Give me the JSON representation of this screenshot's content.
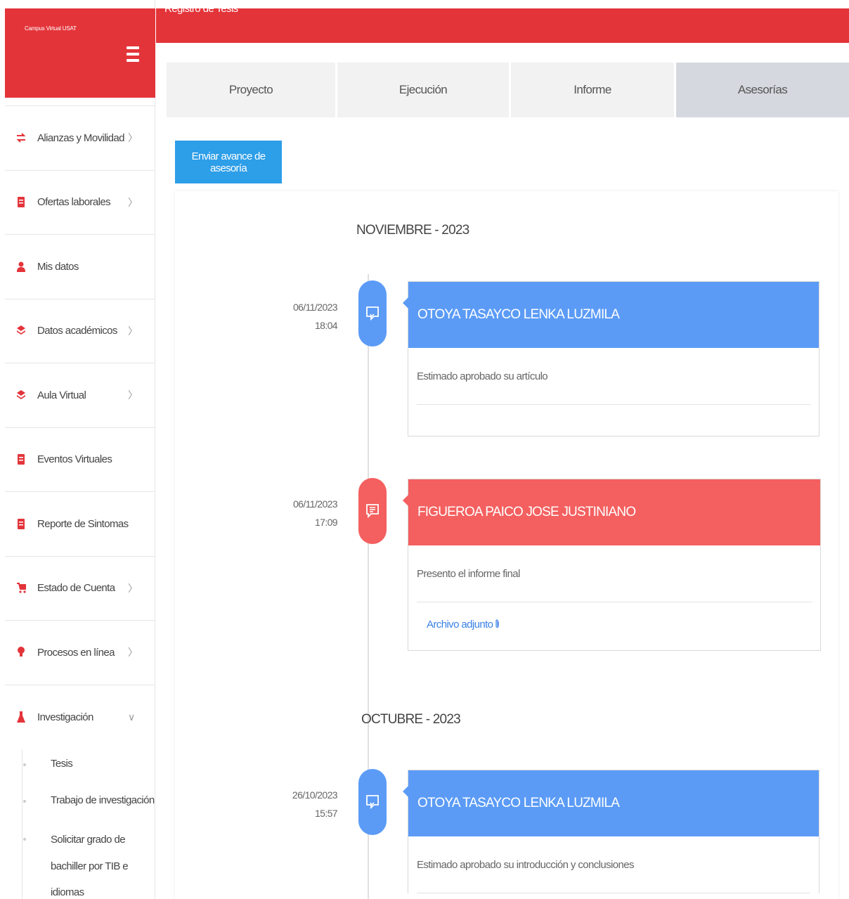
{
  "app": {
    "brand": "Campus Virtual USAT",
    "page_title": "Registro de Tesis"
  },
  "sidebar": {
    "items": [
      {
        "label": "Alianzas y Movilidad",
        "icon": "transfer-icon",
        "has_chevron": true
      },
      {
        "label": "Ofertas laborales",
        "icon": "document-icon",
        "has_chevron": true
      },
      {
        "label": "Mis datos",
        "icon": "user-icon",
        "has_chevron": false
      },
      {
        "label": "Datos académicos",
        "icon": "layers-icon",
        "has_chevron": true
      },
      {
        "label": "Aula Virtual",
        "icon": "layers-icon",
        "has_chevron": true
      },
      {
        "label": "Eventos Virtuales",
        "icon": "document-icon",
        "has_chevron": false
      },
      {
        "label": "Reporte de Sintomas",
        "icon": "document-icon",
        "has_chevron": false
      },
      {
        "label": "Estado de Cuenta",
        "icon": "cart-icon",
        "has_chevron": true
      },
      {
        "label": "Procesos en línea",
        "icon": "lightbulb-icon",
        "has_chevron": true
      },
      {
        "label": "Investigación",
        "icon": "flask-icon",
        "has_chevron": true,
        "expanded": true
      }
    ],
    "chevron_right": "〉",
    "chevron_down": "∨",
    "subitems": [
      {
        "label": "Tesis"
      },
      {
        "label": "Trabajo de investigación"
      },
      {
        "label": "Solicitar grado de bachiller por TIB e idiomas"
      }
    ]
  },
  "tabs": [
    {
      "label": "Proyecto",
      "active": false
    },
    {
      "label": "Ejecución",
      "active": false
    },
    {
      "label": "Informe",
      "active": false
    },
    {
      "label": "Asesorías",
      "active": true
    }
  ],
  "actions": {
    "send_progress": "Enviar avance de asesoría"
  },
  "timeline": {
    "months": [
      {
        "label": "NOVIEMBRE - 2023"
      },
      {
        "label": "OCTUBRE - 2023"
      }
    ],
    "entries": [
      {
        "date": "06/11/2023",
        "time": "18:04",
        "author": "OTOYA TASAYCO LENKA LUZMILA",
        "message": "Estimado aprobado su artículo",
        "color": "#5b9bf6",
        "icon": "chat-bubble-icon"
      },
      {
        "date": "06/11/2023",
        "time": "17:09",
        "author": "FIGUEROA PAICO JOSE JUSTINIANO",
        "message": "Presento el informe final",
        "attachment_label": "Archivo adjunto",
        "color": "#f45f5f",
        "icon": "message-icon"
      },
      {
        "date": "26/10/2023",
        "time": "15:57",
        "author": "OTOYA TASAYCO LENKA LUZMILA",
        "message": "Estimado aprobado su introducción y conclusiones",
        "color": "#5b9bf6",
        "icon": "chat-bubble-icon"
      }
    ]
  },
  "colors": {
    "brand_red": "#e3343a",
    "primary_blue": "#2d9ee8",
    "advisor_blue": "#5b9bf6",
    "student_red": "#f45f5f"
  }
}
